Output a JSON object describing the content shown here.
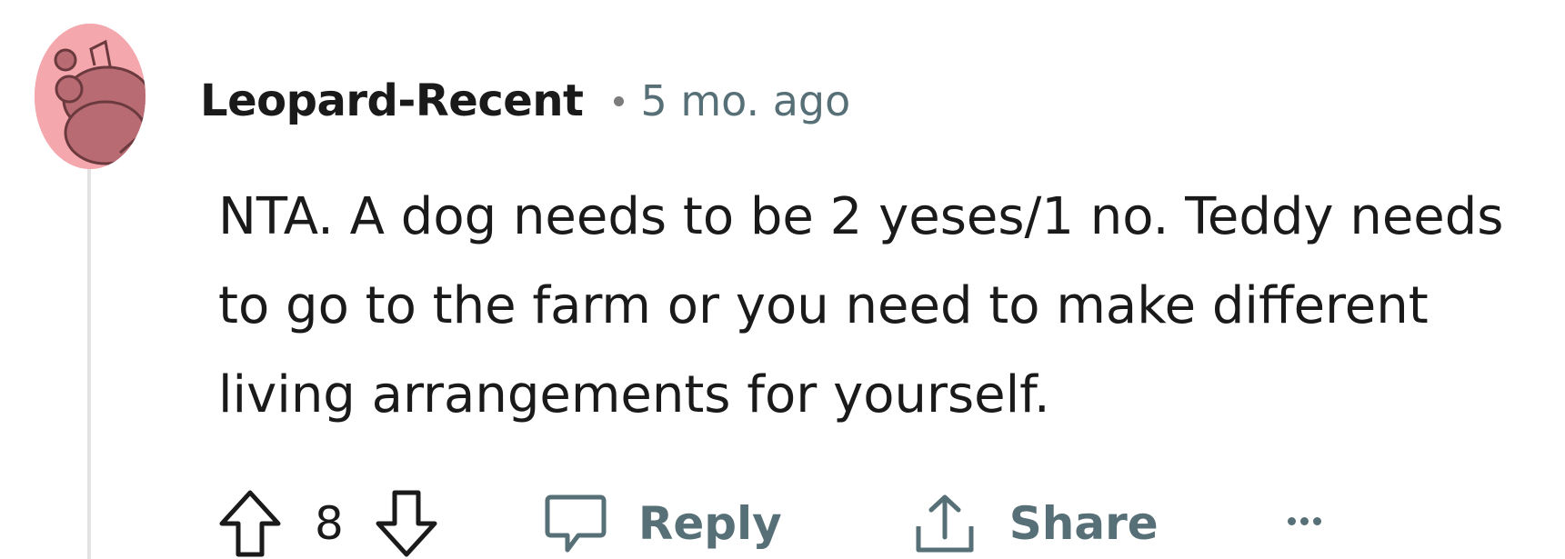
{
  "comment": {
    "author": "Leopard-Recent",
    "separator": "•",
    "timestamp": "5 mo. ago",
    "avatar_icon": "snoo-avatar-icon",
    "avatar_color": "#f4a7ad",
    "body": "NTA. A dog needs to be 2 yeses/1 no. Teddy needs to go to the farm or you need to make different living arrangements for yourself."
  },
  "actions": {
    "upvote_icon": "arrow-up-icon",
    "vote_count": "8",
    "downvote_icon": "arrow-down-icon",
    "reply_icon": "speech-bubble-icon",
    "reply_label": "Reply",
    "share_icon": "share-icon",
    "share_label": "Share",
    "more_icon": "more-horizontal-icon"
  },
  "colors": {
    "text_primary": "#1a1a1b",
    "text_secondary": "#576f76",
    "thread_line": "#e2e2e2"
  }
}
